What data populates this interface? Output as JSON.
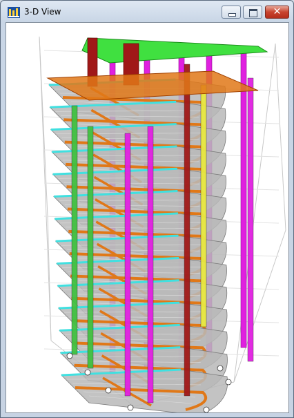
{
  "window": {
    "title": "3-D View",
    "icon": "etabs-app-icon",
    "controls": {
      "minimize": "minimize-icon",
      "maximize": "maximize-icon",
      "close": "close-icon"
    }
  },
  "viewport": {
    "content": "3d-building-model",
    "colors": {
      "slab": "#b8b8b8",
      "beam": "#e07818",
      "column": "#e020e0",
      "wall": "#40c040",
      "edge_beam": "#40e0e0",
      "brace": "#e8e840",
      "roof": "#40e040",
      "accent_wall": "#a01818",
      "grid": "#c8c8c8"
    }
  }
}
